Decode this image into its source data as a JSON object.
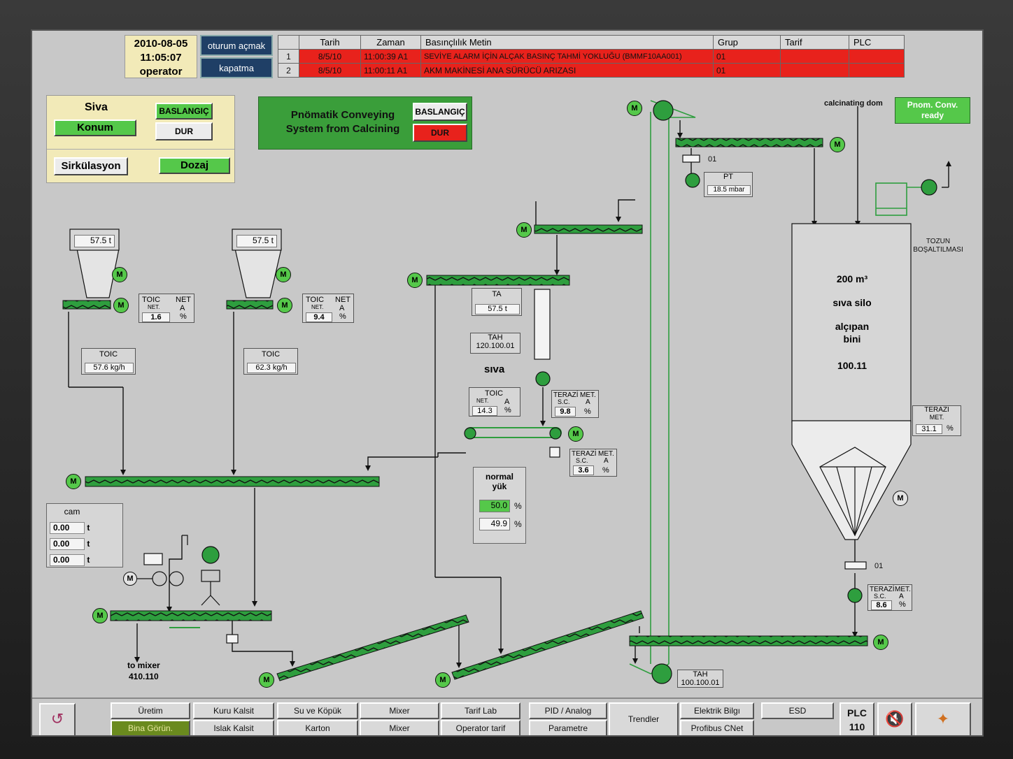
{
  "header": {
    "date": "2010-08-05",
    "time": "11:05:07",
    "user": "operator",
    "login_label": "oturum açmak",
    "close_label": "kapatma"
  },
  "alarms": {
    "columns": [
      "Tarih",
      "Zaman",
      "Basınçlılık Metin",
      "Grup",
      "Tarif",
      "PLC"
    ],
    "rows": [
      {
        "n": "1",
        "date": "8/5/10",
        "time": "11:00:39  A1",
        "text": "SEVİYE ALARM İÇİN ALÇAK BASINÇ TAHMİ YOKLUĞU (BMMF10AA001)",
        "group": "01"
      },
      {
        "n": "2",
        "date": "8/5/10",
        "time": "11:00:11  A1",
        "text": "AKM MAKİNESİ ANA SÜRÜCÜ ARIZASI",
        "group": "01"
      }
    ]
  },
  "siva_panel": {
    "title": "Siva",
    "konum": "Konum",
    "start": "BASLANGIÇ",
    "stop": "DUR",
    "sirk": "Sirkülasyon",
    "dozaj": "Dozaj"
  },
  "pnom": {
    "line1": "Pnömatik Conveying",
    "line2": "System from Calcining",
    "start": "BASLANGIÇ",
    "stop": "DUR"
  },
  "calc_dom": "calcinating dom",
  "ready": {
    "line1": "Pnom. Conv.",
    "line2": "ready"
  },
  "motor_label": "M",
  "hoppers": [
    {
      "weight": "57.5",
      "unit": "t",
      "net": "1.6",
      "toic": "57.6",
      "toic_unit": "kg/h"
    },
    {
      "weight": "57.5",
      "unit": "t",
      "net": "9.4",
      "toic": "62.3",
      "toic_unit": "kg/h"
    }
  ],
  "labels": {
    "toic": "TOIC",
    "net": "NET.",
    "net2": "NET",
    "a": "A",
    "pct": "%",
    "ta": "TA",
    "tah": "TAH",
    "terazi": "TERAZİ",
    "terazi2": "TERAZI",
    "sc": "S.C.",
    "met": "MET.",
    "pt": "PT",
    "tozun1": "TOZUN",
    "tozun2": "BOŞALTILMASI",
    "valve01": "01"
  },
  "ta": {
    "value": "57.5",
    "unit": "t"
  },
  "tah_mid": "120.100.01",
  "siva_label": "sıva",
  "toic_mid": {
    "net": "14.3"
  },
  "terazi1": {
    "value": "9.8"
  },
  "terazi2": {
    "value": "3.6"
  },
  "terazi_silo": {
    "value": "31.1"
  },
  "terazi_bottom": {
    "value": "8.6"
  },
  "pt": {
    "value": "18.5",
    "unit": "mbar"
  },
  "silo": {
    "volume": "200 m³",
    "name": "sıva silo",
    "type1": "alçıpan",
    "type2": "bini",
    "tag": "100.11"
  },
  "normal": {
    "line1": "normal",
    "line2": "yük",
    "v1": "50.0",
    "v2": "49.9",
    "unit": "%"
  },
  "cam": {
    "title": "cam",
    "values": [
      "0.00",
      "0.00",
      "0.00"
    ],
    "unit": "t"
  },
  "mixer_target": {
    "line1": "to mixer",
    "line2": "410.110"
  },
  "tah_bottom": "100.100.01",
  "nav": {
    "uretim": "Üretim",
    "bina": "Bina Görün.",
    "kuru": "Kuru Kalsit",
    "islak": "Islak Kalsit",
    "su": "Su ve Köpük",
    "karton": "Karton",
    "mixer1": "Mixer",
    "mixer2": "Mixer",
    "tarif": "Tarif Lab",
    "optarif": "Operator tarif",
    "pid": "PID / Analog",
    "param": "Parametre",
    "trend": "Trendler",
    "elektrik": "Elektrik Bilgı",
    "profibus": "Profibus CNet",
    "esd": "ESD",
    "plc1": "PLC",
    "plc2": "110"
  },
  "colors": {
    "alarm": "#e8221c",
    "green": "#55c84a",
    "conveyor": "#2e9e3e",
    "panel": "#f2eab8"
  }
}
